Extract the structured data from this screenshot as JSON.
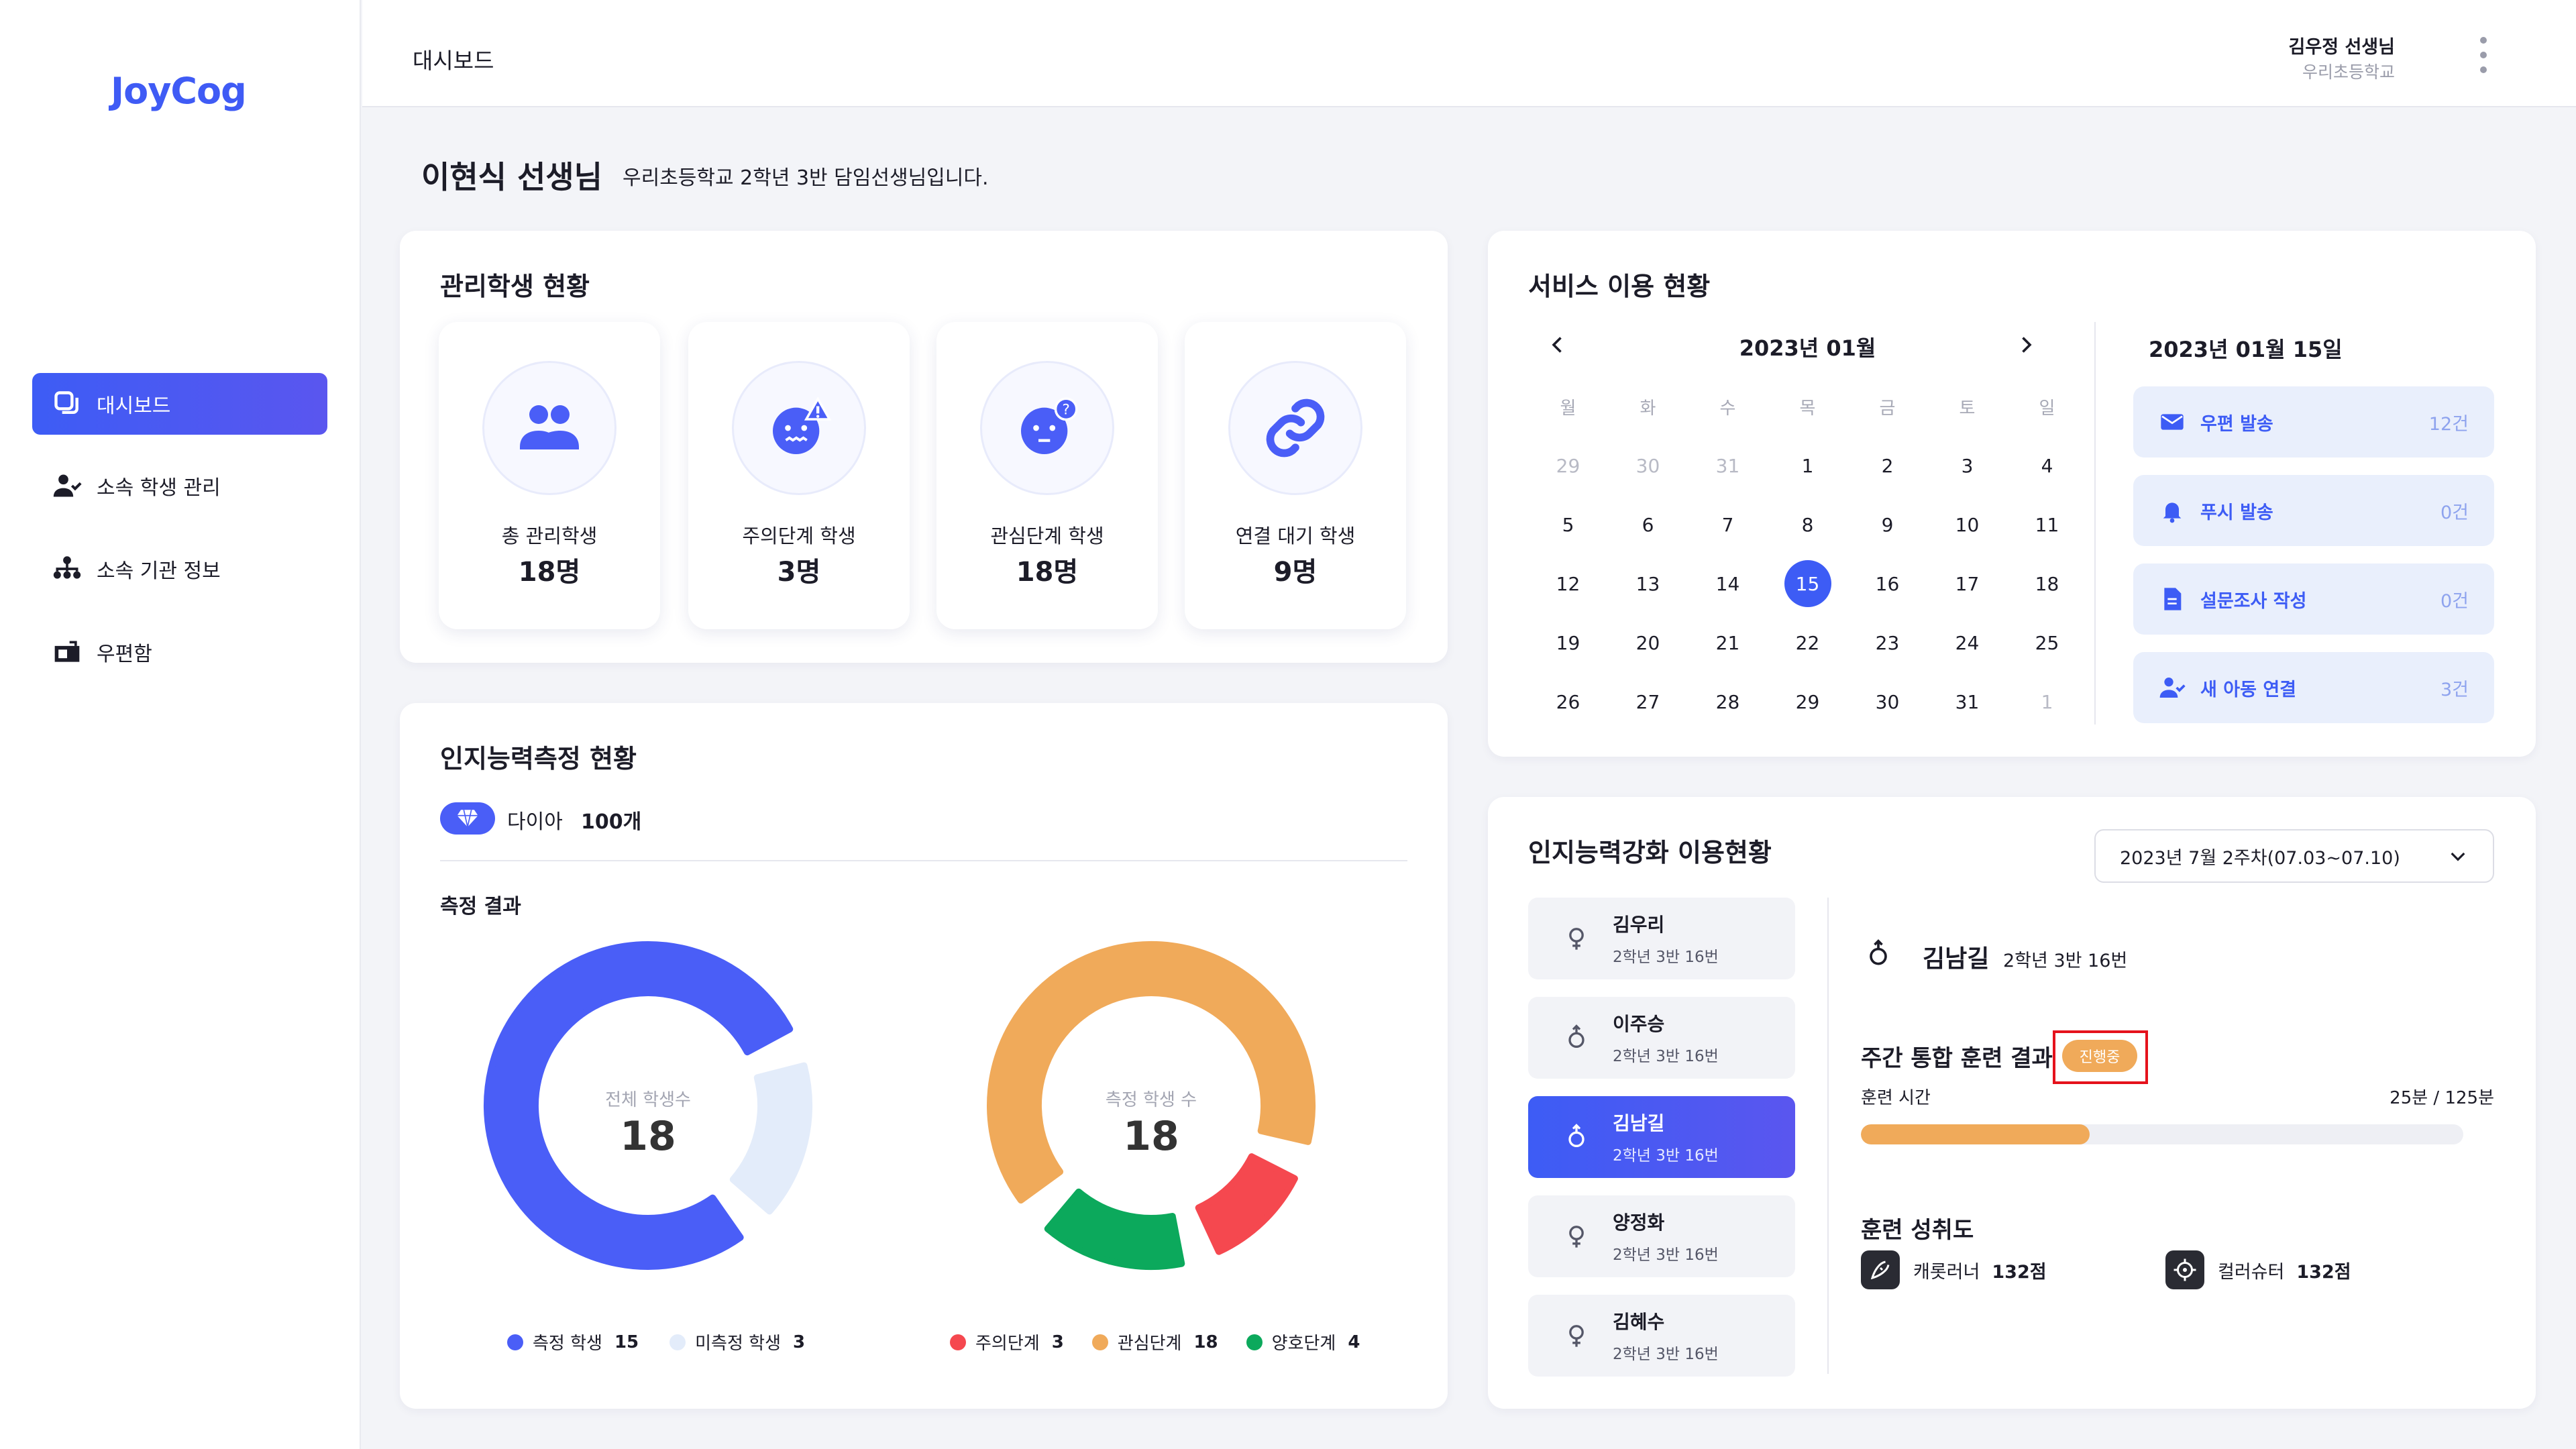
{
  "app": {
    "logo": "JoyCog"
  },
  "header": {
    "title": "대시보드",
    "user_name": "김우정 선생님",
    "user_school": "우리초등학교"
  },
  "sidebar": {
    "items": [
      {
        "label": "대시보드",
        "icon": "dashboard-icon",
        "active": true
      },
      {
        "label": "소속 학생 관리",
        "icon": "user-check-icon",
        "active": false
      },
      {
        "label": "소속 기관 정보",
        "icon": "org-chart-icon",
        "active": false
      },
      {
        "label": "우편함",
        "icon": "mailbox-icon",
        "active": false
      }
    ]
  },
  "teacher": {
    "name": "이현식 선생님",
    "desc": "우리초등학교 2학년 3반 담임선생님입니다."
  },
  "students_status": {
    "title": "관리학생 현황",
    "cards": [
      {
        "label": "총 관리학생",
        "value": "18명",
        "icon": "users-icon"
      },
      {
        "label": "주의단계 학생",
        "value": "3명",
        "icon": "warning-face-icon"
      },
      {
        "label": "관심단계 학생",
        "value": "18명",
        "icon": "question-face-icon"
      },
      {
        "label": "연결 대기 학생",
        "value": "9명",
        "icon": "link-icon"
      }
    ]
  },
  "cognitive": {
    "title": "인지능력측정 현황",
    "diamond_label": "다이아",
    "diamond_count": "100개",
    "result_title": "측정 결과",
    "donut1": {
      "center_label": "전체 학생수",
      "center_value": "18",
      "segments": [
        {
          "name": "측정 학생",
          "value": 15,
          "color": "#4a5ef7"
        },
        {
          "name": "미측정 학생",
          "value": 3,
          "color": "#e3ecfa"
        }
      ]
    },
    "donut2": {
      "center_label": "측정 학생 수",
      "center_value": "18",
      "segments": [
        {
          "name": "관심단계",
          "value": 18,
          "color": "#f0aa5a"
        },
        {
          "name": "주의단계",
          "value": 3,
          "color": "#f5484f"
        },
        {
          "name": "양호단계",
          "value": 4,
          "color": "#0ca95c"
        }
      ],
      "legend": [
        {
          "name": "주의단계",
          "value": "3",
          "color": "#f5484f"
        },
        {
          "name": "관심단계",
          "value": "18",
          "color": "#f0aa5a"
        },
        {
          "name": "양호단계",
          "value": "4",
          "color": "#0ca95c"
        }
      ]
    }
  },
  "service": {
    "title": "서비스 이용 현황",
    "month": "2023년 01월",
    "weekdays": [
      "월",
      "화",
      "수",
      "목",
      "금",
      "토",
      "일"
    ],
    "weeks": [
      [
        "29",
        "30",
        "31",
        "1",
        "2",
        "3",
        "4"
      ],
      [
        "5",
        "6",
        "7",
        "8",
        "9",
        "10",
        "11"
      ],
      [
        "12",
        "13",
        "14",
        "15",
        "16",
        "17",
        "18"
      ],
      [
        "19",
        "20",
        "21",
        "22",
        "23",
        "24",
        "25"
      ],
      [
        "26",
        "27",
        "28",
        "29",
        "30",
        "31",
        "1"
      ]
    ],
    "selected_day": "15",
    "date_title": "2023년 01월 15일",
    "items": [
      {
        "label": "우편 발송",
        "count": "12건",
        "icon": "mail-icon"
      },
      {
        "label": "푸시 발송",
        "count": "0건",
        "icon": "bell-icon"
      },
      {
        "label": "설문조사 작성",
        "count": "0건",
        "icon": "document-icon"
      },
      {
        "label": "새 아동 연결",
        "count": "3건",
        "icon": "user-add-icon"
      }
    ]
  },
  "training": {
    "title": "인지능력강화 이용현황",
    "week_select": "2023년 7월 2주차(07.03~07.10)",
    "students": [
      {
        "name": "김우리",
        "class": "2학년 3반 16번",
        "gender": "female"
      },
      {
        "name": "이주승",
        "class": "2학년 3반 16번",
        "gender": "male"
      },
      {
        "name": "김남길",
        "class": "2학년 3반 16번",
        "gender": "male",
        "active": true
      },
      {
        "name": "양정화",
        "class": "2학년 3반 16번",
        "gender": "female"
      },
      {
        "name": "김혜수",
        "class": "2학년 3반 16번",
        "gender": "female"
      }
    ],
    "detail": {
      "name": "김남길",
      "class": "2학년 3반 16번",
      "weekly_title": "주간 통합 훈련 결과",
      "status_badge": "진행중",
      "time_label": "훈련 시간",
      "time_value": "25분 / 125분",
      "progress": 0.38,
      "achievement_title": "훈련 성취도",
      "games": [
        {
          "name": "캐롯러너",
          "score": "132점",
          "icon": "carrot-icon"
        },
        {
          "name": "컬러슈터",
          "score": "132점",
          "icon": "crosshair-icon"
        }
      ]
    }
  },
  "colors": {
    "accent": "#3d5cf5",
    "orange": "#f0aa5a",
    "red": "#f5484f",
    "green": "#0ca95c"
  }
}
